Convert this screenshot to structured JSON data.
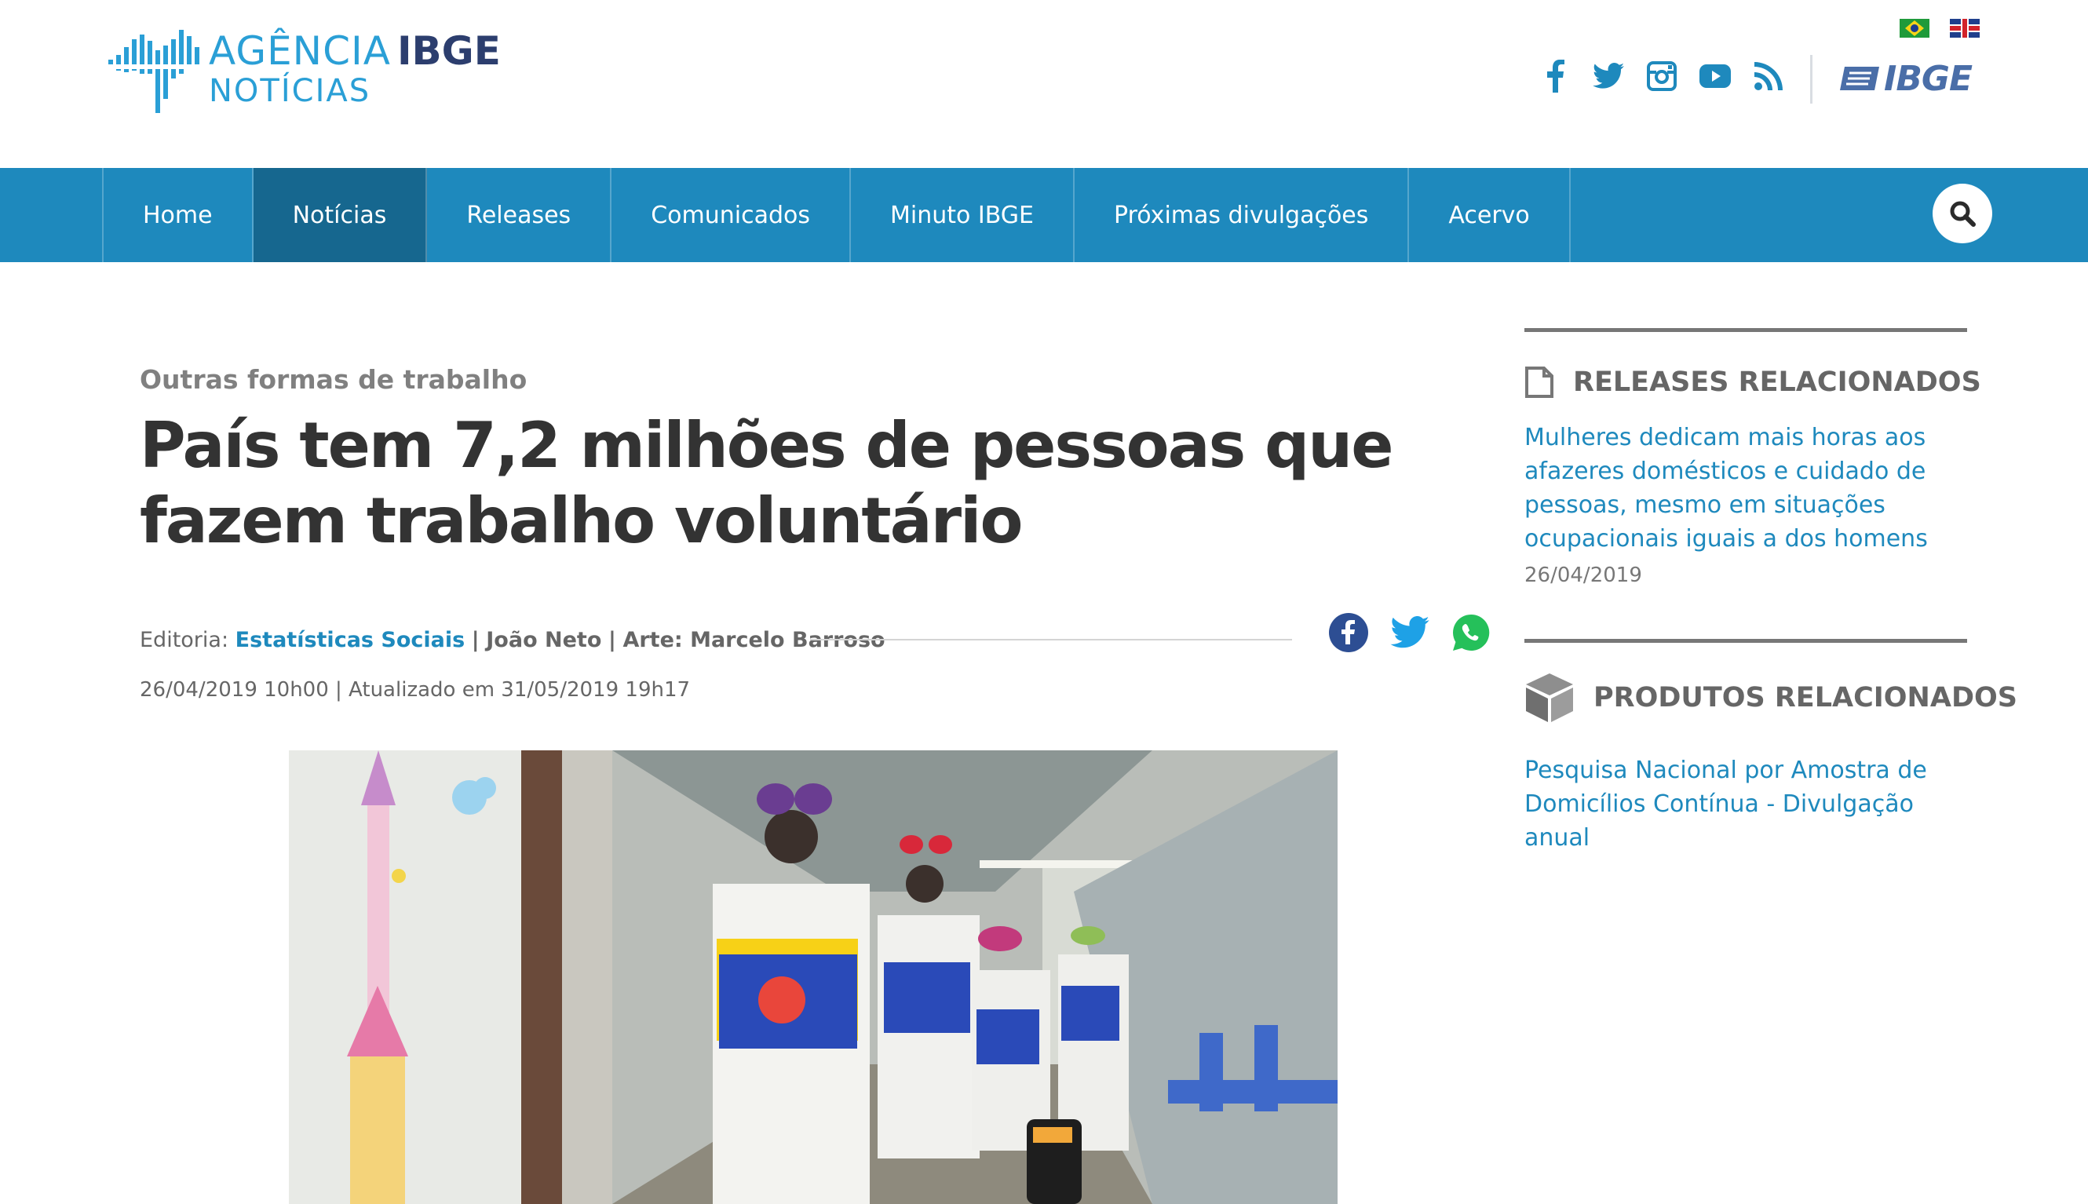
{
  "brand": {
    "agencia": "AGÊNCIA",
    "ibge": "IBGE",
    "noticias": "NOTÍCIAS",
    "ibge_logo": "IBGE",
    "primary_color": "#1e89bd",
    "active_color": "#16678f"
  },
  "header": {
    "languages": [
      "pt-BR flag",
      "en-GB flag"
    ],
    "social": [
      "facebook-icon",
      "twitter-icon",
      "instagram-icon",
      "youtube-icon",
      "rss-icon"
    ]
  },
  "nav": {
    "items": [
      {
        "label": "Home",
        "active": false
      },
      {
        "label": "Notícias",
        "active": true
      },
      {
        "label": "Releases",
        "active": false
      },
      {
        "label": "Comunicados",
        "active": false
      },
      {
        "label": "Minuto IBGE",
        "active": false
      },
      {
        "label": "Próximas divulgações",
        "active": false
      },
      {
        "label": "Acervo",
        "active": false
      }
    ],
    "search_icon": "search-icon"
  },
  "article": {
    "kicker": "Outras formas de trabalho",
    "title": "País tem 7,2 milhões de pessoas que fazem trabalho voluntário",
    "meta": {
      "editoria_label": "Editoria:",
      "editoria_value": "Estatísticas Sociais",
      "separator": "|",
      "author": "João Neto",
      "art": "Arte: Marcelo Barroso"
    },
    "dates": "26/04/2019 10h00 | Atualizado em 31/05/2019 19h17",
    "share": [
      "facebook-share-icon",
      "twitter-share-icon",
      "whatsapp-share-icon"
    ]
  },
  "sidebar": {
    "releases": {
      "heading": "RELEASES RELACIONADOS",
      "icon": "document-icon",
      "items": [
        {
          "title": "Mulheres dedicam mais horas aos afazeres domésticos e cuidado de pessoas, mesmo em situações ocupacionais iguais a dos homens",
          "date": "26/04/2019"
        }
      ]
    },
    "produtos": {
      "heading": "PRODUTOS RELACIONADOS",
      "icon": "cube-icon",
      "items": [
        {
          "title": "Pesquisa Nacional por Amostra de Domicílios Contínua - Divulgação anual"
        }
      ]
    }
  }
}
